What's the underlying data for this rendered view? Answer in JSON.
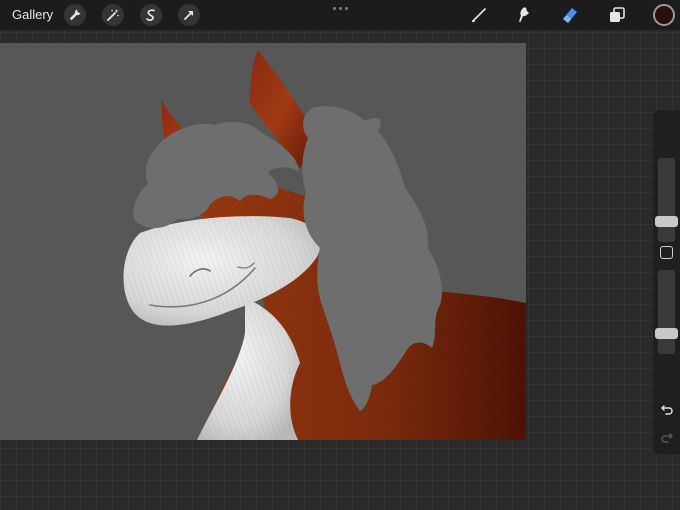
{
  "toolbar": {
    "gallery_label": "Gallery",
    "left_tools": [
      "wrench-icon",
      "magic-wand-icon",
      "selection-icon",
      "transform-arrow-icon"
    ],
    "right_tools": [
      "brush-icon",
      "smudge-icon",
      "eraser-icon",
      "layers-icon"
    ],
    "active_tool": "eraser",
    "accent_color": "#4a8fe8",
    "current_color": "#2b0f0c"
  },
  "sidebar": {
    "brush_size": 0.2,
    "opacity": 0.2
  },
  "canvas": {
    "background_color": "#575757",
    "subject": "horse-painting"
  }
}
